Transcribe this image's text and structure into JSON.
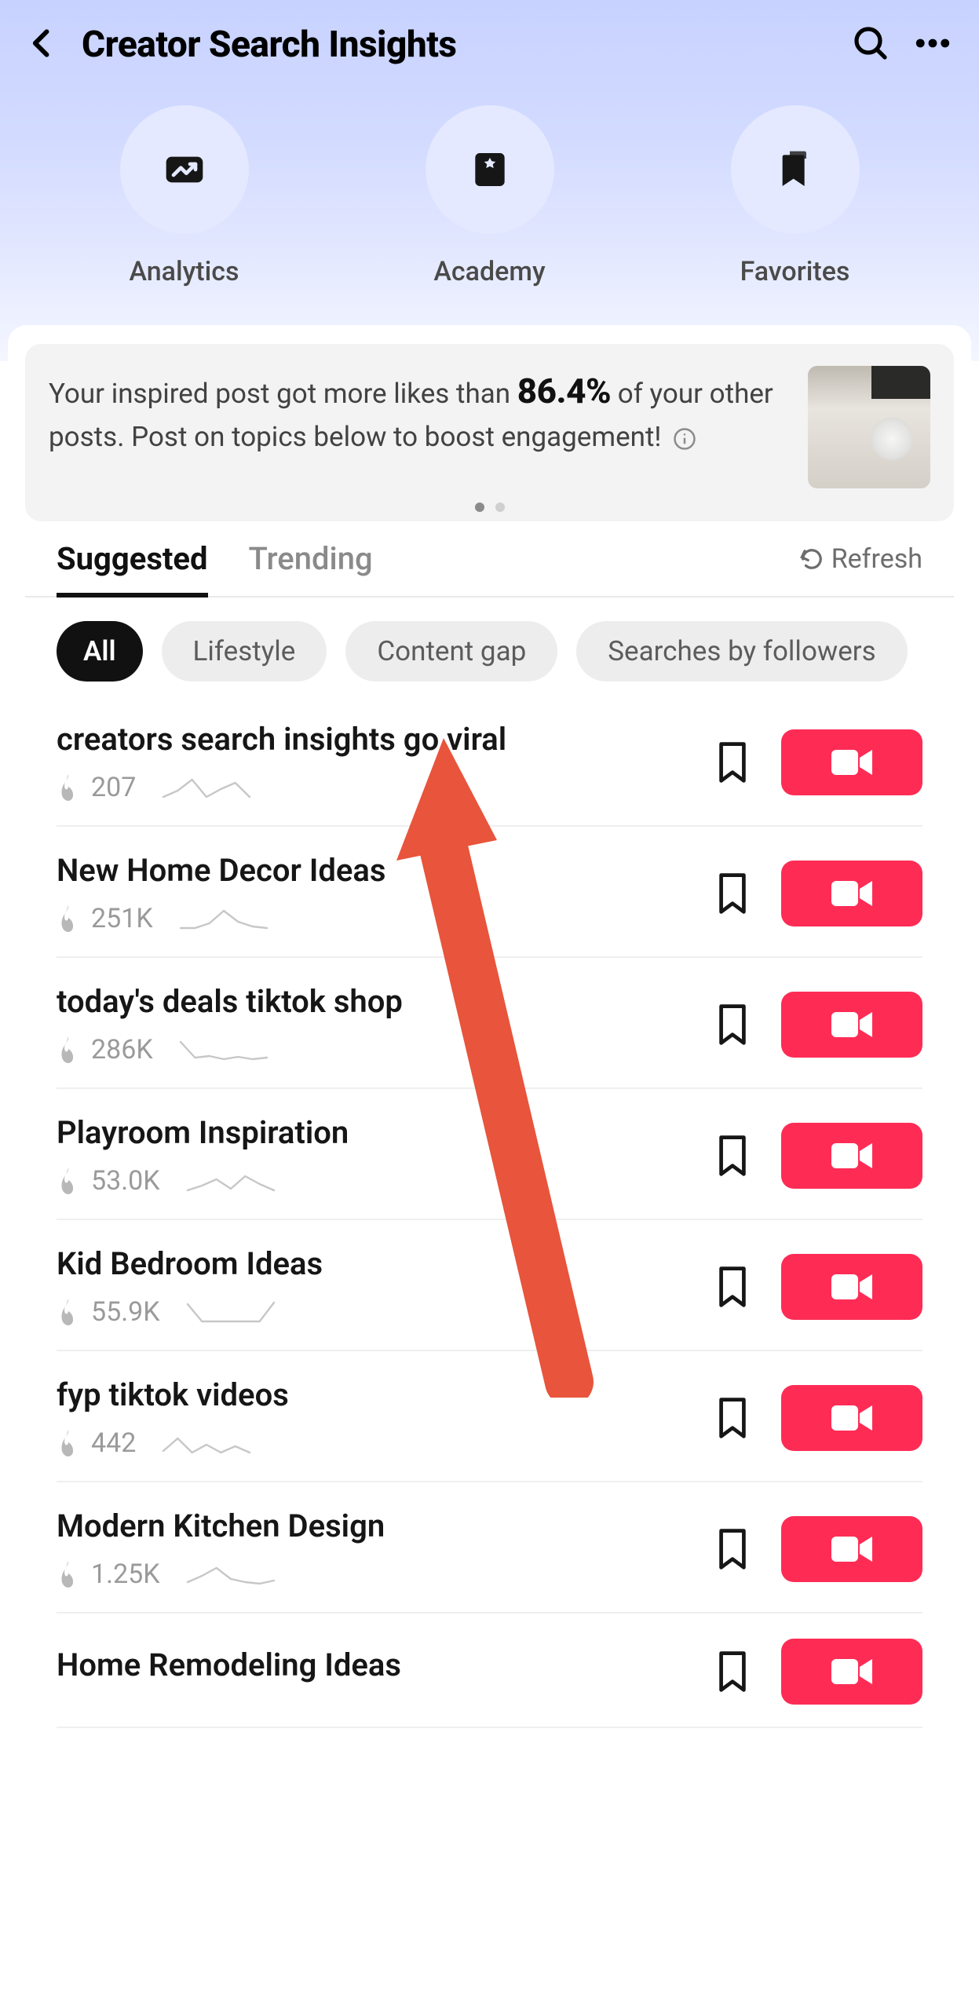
{
  "header": {
    "title": "Creator Search Insights"
  },
  "quick_nav": {
    "analytics": "Analytics",
    "academy": "Academy",
    "favorites": "Favorites"
  },
  "insight": {
    "text_before": "Your inspired post got more likes than ",
    "pct": "86.4%",
    "text_after": " of your other posts. Post on topics below to boost engagement!"
  },
  "tabs": {
    "suggested": "Suggested",
    "trending": "Trending",
    "refresh": "Refresh"
  },
  "filters": {
    "all": "All",
    "lifestyle": "Lifestyle",
    "content_gap": "Content gap",
    "followers": "Searches by followers"
  },
  "topics": [
    {
      "title": "creators search insights go viral",
      "count": "207",
      "spark": "30,22,8,30,20,12,30"
    },
    {
      "title": "New Home Decor Ideas",
      "count": "251K",
      "spark": "30,30,24,8,22,28,30"
    },
    {
      "title": "today's deals tiktok shop",
      "count": "286K",
      "spark": "8,28,26,30,27,30,28"
    },
    {
      "title": "Playroom Inspiration",
      "count": "53.0K",
      "spark": "30,24,16,28,12,22,30"
    },
    {
      "title": "Kid Bedroom Ideas",
      "count": "55.9K",
      "spark": "8,30,30,30,30,30,6"
    },
    {
      "title": "fyp tiktok videos",
      "count": "442",
      "spark": "28,12,30,20,30,22,30"
    },
    {
      "title": "Modern Kitchen Design",
      "count": "1.25K",
      "spark": "28,20,10,24,28,30,26"
    },
    {
      "title": "Home Remodeling Ideas",
      "count": "",
      "spark": ""
    }
  ]
}
